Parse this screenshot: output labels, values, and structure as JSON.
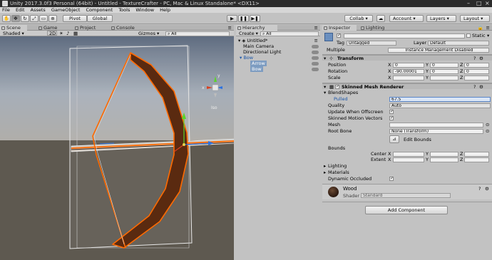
{
  "titlebar": {
    "text": "Unity 2017.3.0f3 Personal (64bit) - Untitled - TextureCrafter - PC, Mac & Linux Standalone* <DX11>"
  },
  "menu": [
    "File",
    "Edit",
    "Assets",
    "GameObject",
    "Component",
    "Tools",
    "Window",
    "Help"
  ],
  "toolbar": {
    "pivot": "Pivot",
    "global": "Global",
    "collab": "Collab ▾",
    "account": "Account",
    "layers": "Layers",
    "layout": "Layout",
    "play_icon": "play-icon",
    "pause_icon": "pause-icon",
    "step_icon": "step-icon"
  },
  "scene": {
    "tabs": [
      "Scene",
      "Game",
      "Project",
      "Console"
    ],
    "shading": "Shaded",
    "mode_2d": "2D",
    "gizmos": "Gizmos",
    "search": "All",
    "axis_y": "y",
    "axis_x": "x",
    "persp": "Iso"
  },
  "hierarchy": {
    "tab": "Hierarchy",
    "create": "Create",
    "search": "All",
    "scene_name": "Untitled*",
    "items": [
      {
        "label": "Main Camera"
      },
      {
        "label": "Directional Light"
      },
      {
        "label": "Bow"
      },
      {
        "label": "Arrow"
      },
      {
        "label": "Bow"
      }
    ]
  },
  "inspector": {
    "tabs": [
      "Inspector",
      "Lighting"
    ],
    "object_name": "",
    "static_label": "Static",
    "tag_label": "Tag",
    "tag_value": "Untagged",
    "layer_label": "Layer",
    "layer_value": "Default",
    "multiple_label": "Multiple",
    "instance_note": "Instance Management Disabled",
    "transform": {
      "title": "Transform",
      "position_label": "Position",
      "rotation_label": "Rotation",
      "scale_label": "Scale",
      "axis_x": "X",
      "axis_y": "Y",
      "axis_z": "Z",
      "position": [
        "0",
        "0",
        "0"
      ],
      "rotation": [
        "-90.00001",
        "0",
        "0"
      ],
      "scale": [
        "",
        "",
        ""
      ]
    },
    "smr": {
      "title": "Skinned Mesh Renderer",
      "blendshapes_label": "BlendShapes",
      "pulled_label": "Pulled",
      "pulled_value": "67.5",
      "quality_label": "Quality",
      "quality_value": "Auto",
      "update_label": "Update When Offscreen",
      "motion_label": "Skinned Motion Vectors",
      "mesh_label": "Mesh",
      "mesh_value": "",
      "rootbone_label": "Root Bone",
      "rootbone_value": "None (Transform)",
      "edit_bounds": "Edit Bounds",
      "bounds_label": "Bounds",
      "center_label": "Center",
      "extent_label": "Extent",
      "lighting_label": "Lighting",
      "materials_label": "Materials",
      "occluded_label": "Dynamic Occluded"
    },
    "material": {
      "name": "Wood",
      "shader_label": "Shader",
      "shader_value": "Standard"
    },
    "add_component": "Add Component"
  },
  "colors": {
    "bow_outline": "#ff6a00",
    "bow_fill": "#5a2a10",
    "sky": "#7f8ea3",
    "ground": "#5e5950",
    "selection": "#3d7fc2"
  }
}
